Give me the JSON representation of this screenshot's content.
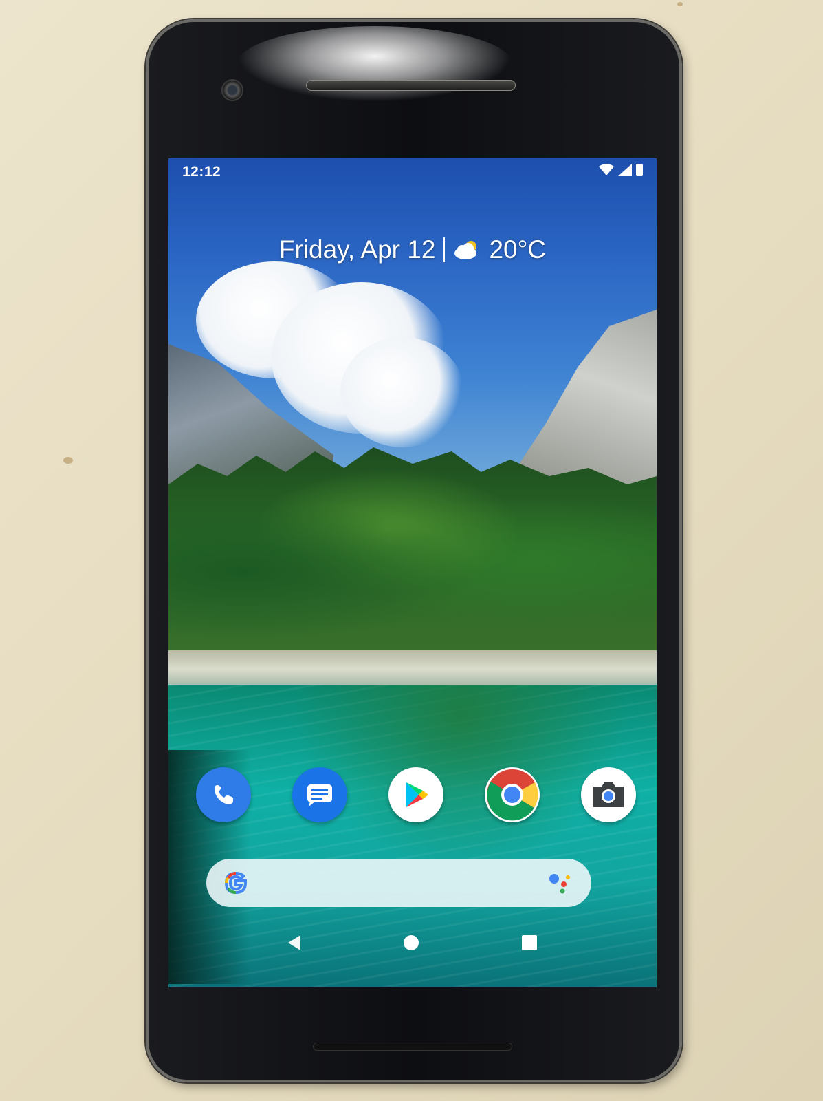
{
  "status_bar": {
    "time": "12:12",
    "icons": [
      "wifi-icon",
      "signal-icon",
      "battery-icon"
    ]
  },
  "at_a_glance": {
    "date": "Friday, Apr 12",
    "weather_icon": "partly-cloudy-icon",
    "temperature": "20°C"
  },
  "dock": {
    "apps": [
      {
        "name": "Phone",
        "icon": "phone-icon",
        "color": "#2f7be8"
      },
      {
        "name": "Messages",
        "icon": "messages-icon",
        "color": "#1b73e8"
      },
      {
        "name": "Play Store",
        "icon": "play-store-icon",
        "color": "#ffffff"
      },
      {
        "name": "Chrome",
        "icon": "chrome-icon",
        "color": "#ffffff"
      },
      {
        "name": "Camera",
        "icon": "camera-icon",
        "color": "#ffffff"
      }
    ]
  },
  "search_bar": {
    "left_icon": "google-g-icon",
    "right_icon": "assistant-icon"
  },
  "nav_bar": {
    "buttons": [
      "back-button",
      "home-button",
      "recents-button"
    ]
  }
}
